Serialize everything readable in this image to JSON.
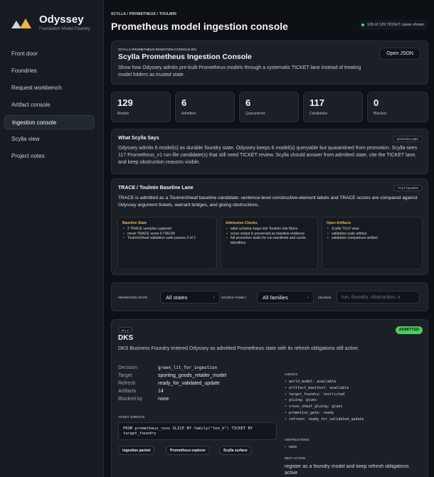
{
  "brand": {
    "name": "Odyssey",
    "subtitle": "Foundation Model Foundry"
  },
  "nav": [
    {
      "label": "Front door"
    },
    {
      "label": "Foundries"
    },
    {
      "label": "Request workbench"
    },
    {
      "label": "Artifact console"
    },
    {
      "label": "Ingestion console",
      "active": true
    },
    {
      "label": "Scylla view"
    },
    {
      "label": "Project notes"
    }
  ],
  "header": {
    "breadcrumb": "SCYLLA / PROMETHEUS / TOULMIN",
    "title": "Prometheus model ingestion console",
    "status": "129 of 129 TICKET cases shown"
  },
  "console_card": {
    "kicker": "SCYLLA-PROMETHEUS-INGESTION-CONSOLE-001",
    "title": "Scylla Prometheus Ingestion Console",
    "description": "Show how Odyssey admits pre-built Prometheus models through a systematic TICKET lane instead of treating model folders as trusted state.",
    "open_json": "Open JSON"
  },
  "stats": [
    {
      "value": "129",
      "label": "Models"
    },
    {
      "value": "6",
      "label": "Admitted"
    },
    {
      "value": "6",
      "label": "Quarantined"
    },
    {
      "value": "117",
      "label": "Candidates"
    },
    {
      "value": "0",
      "label": "Blocked"
    }
  ],
  "scylla_says": {
    "title": "What Scylla Says",
    "tag": "promotion gate",
    "body": "Odyssey admits 6 model(s) as durable foundry state. Odyssey keeps 6 model(s) queryable but quarantined from promotion. Scylla sees 117 Prometheus_v1 run-file candidate(s) that still need TICKET review. Scylla should answer from admitted state, cite the TICKET lane, and keep obstruction reasons visible."
  },
  "trace": {
    "title": "TRACE / Toulmin Baseline Lane",
    "tag": "TCoT baseline",
    "body": "TRACE is admitted as a ToulminSheaf baseline candidate: sentence-level constructive-element labels and TRACE scores are compared against Odyssey argument tickets, warrant bridges, and gluing obstructions.",
    "columns": [
      {
        "title": "Baseline State",
        "items": [
          "2 TRACE samples captured",
          "mean TRACE score 0.736199",
          "ToulminSheaf validation suite passes 2 of 2"
        ]
      },
      {
        "title": "Admission Checks",
        "items": [
          "label schema maps into Toulmin role fibers",
          "score output is preserved as baseline evidence",
          "full promotion waits for run manifests and cache identifiers"
        ]
      },
      {
        "title": "Open Artifacts",
        "items": [
          "Scylla TCoT view",
          "validation suite artifact",
          "validation comparison artifact"
        ]
      }
    ]
  },
  "filters": {
    "promotion_label": "PROMOTION STATE",
    "promotion_value": "All states",
    "source_label": "SOURCE FAMILY",
    "source_value": "All families",
    "search_label": "SEARCH",
    "search_placeholder": "run, foundry, obstruction, s"
  },
  "dks": {
    "chip": "ten_k",
    "badge": "ADMITTED",
    "title": "DKS",
    "description": "DKS Business Foundry entered Odyssey as admitted Prometheus state with its refresh obligations still active.",
    "fields": [
      {
        "key": "Decision",
        "value": "green_lit_for_ingestion",
        "mono": true
      },
      {
        "key": "Target",
        "value": "sporting_goods_retailer_model"
      },
      {
        "key": "Refresh",
        "value": "ready_for_validated_update"
      },
      {
        "key": "Artifacts",
        "value": "14"
      },
      {
        "key": "Blocked by",
        "value": "none"
      }
    ],
    "ticket_surface_label": "TICKET SURFACE",
    "ticket_surface": "FROM prometheus_runs SLICE BY family(\"ten_k\") TICKET BY target_foundry",
    "buttons": [
      "ingestion packet",
      "Prometheus explorer",
      "Scylla surface"
    ],
    "checks_label": "CHECKS",
    "checks": [
      "world_model: available",
      "artifact_manifest: available",
      "target_foundry: restricted",
      "gluing: glues",
      "cross_sheaf_gluing: glues",
      "promotion_gate: ready",
      "refresh: ready_for_validated_update"
    ],
    "obstructions_label": "OBSTRUCTIONS",
    "obstructions": [
      "none"
    ],
    "next_action_label": "NEXT ACTION",
    "next_action": "register as a foundry model and keep refresh obligations active"
  },
  "colors": {
    "accent_orange": "#e6b45a",
    "admitted_green": "#4ecb5e",
    "background": "#0d1014"
  }
}
